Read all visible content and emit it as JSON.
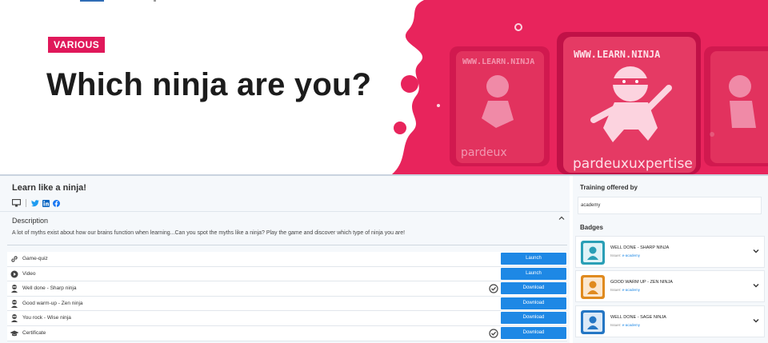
{
  "hero": {
    "tag": "VARIOUS",
    "title": "Which ninja are you?",
    "art_url_text": "WWW.LEARN.NINJA",
    "art_brand": "pardeux",
    "art_brand2": "uxpertise",
    "colors": {
      "tag": "#e0185a",
      "art": "#e8245c"
    }
  },
  "course": {
    "title": "Learn like a ninja!",
    "share_icons": [
      "monitor-icon",
      "twitter-icon",
      "linkedin-icon",
      "facebook-icon"
    ],
    "description_label": "Description",
    "description_text": "A lot of myths exist about how our brains function when learning...Can you spot the myths like a ninja? Play the game and discover which type of ninja you are!",
    "activities": [
      {
        "label": "Game-quiz",
        "icon": "link-icon",
        "button": "Launch",
        "checked": false
      },
      {
        "label": "Video",
        "icon": "play-icon",
        "button": "Launch",
        "checked": false
      },
      {
        "label": "Well done - Sharp ninja",
        "icon": "ninja-icon",
        "button": "Download",
        "checked": true
      },
      {
        "label": "Good warm-up - Zen ninja",
        "icon": "ninja-icon",
        "button": "Download",
        "checked": false
      },
      {
        "label": "You rock - Wise ninja",
        "icon": "ninja-icon",
        "button": "Download",
        "checked": false
      },
      {
        "label": "Certificate",
        "icon": "graduation-cap-icon",
        "button": "Download",
        "checked": true
      }
    ]
  },
  "sidebar": {
    "training_title": "Training offered by",
    "academy": "academy",
    "badges_title": "Badges",
    "issuer_label": "Issuer:",
    "badges": [
      {
        "name": "WELL DONE - SHARP NINJA",
        "issuer": "e-academy",
        "color": "#2a9fb6"
      },
      {
        "name": "GOOD WARM UP - ZEN NINJA",
        "issuer": "e-academy",
        "color": "#e08a1e"
      },
      {
        "name": "WELL DONE - SAGE NINJA",
        "issuer": "e-academy",
        "color": "#2476c4"
      }
    ]
  }
}
